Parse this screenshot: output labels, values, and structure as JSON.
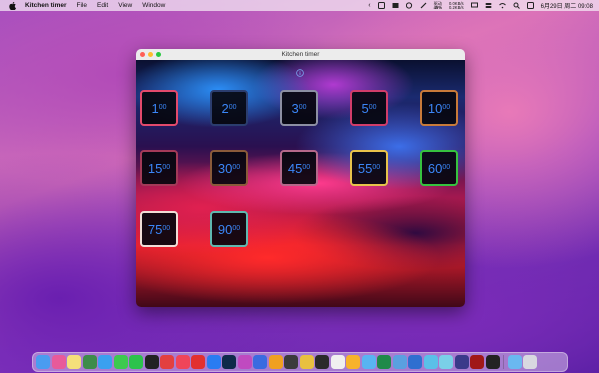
{
  "menubar": {
    "app_name": "Kitchen timer",
    "items": [
      "File",
      "Edit",
      "View",
      "Window"
    ],
    "stats_top": "驱动",
    "stats_pct": "45%",
    "stats_net_top": "0.0KB/s",
    "stats_net_bottom": "0.2KB/s",
    "datetime": "6月29日 周二  09:08"
  },
  "window": {
    "title": "Kitchen timer"
  },
  "timers": [
    {
      "value": "1",
      "unit": "00",
      "border": "#e24a6c"
    },
    {
      "value": "2",
      "unit": "00",
      "border": "#2b3d6e"
    },
    {
      "value": "3",
      "unit": "00",
      "border": "#8c8fa3"
    },
    {
      "value": "5",
      "unit": "00",
      "border": "#d13d6a"
    },
    {
      "value": "10",
      "unit": "00",
      "border": "#c77a3a"
    },
    {
      "value": "15",
      "unit": "00",
      "border": "#a33a58"
    },
    {
      "value": "30",
      "unit": "00",
      "border": "#8a5a3a"
    },
    {
      "value": "45",
      "unit": "00",
      "border": "#b4688a"
    },
    {
      "value": "55",
      "unit": "00",
      "border": "#e7c34b"
    },
    {
      "value": "60",
      "unit": "00",
      "border": "#36c23f"
    },
    {
      "value": "75",
      "unit": "00",
      "border": "#f0dcd6"
    },
    {
      "value": "90",
      "unit": "00",
      "border": "#5fb8b0"
    }
  ],
  "dock": {
    "apps": [
      {
        "name": "finder",
        "color": "#4a9cf0"
      },
      {
        "name": "launchpad",
        "color": "#e85a9a"
      },
      {
        "name": "notes",
        "color": "#f5e07a"
      },
      {
        "name": "terminal-app",
        "color": "#3d8c4a"
      },
      {
        "name": "safari",
        "color": "#3aa0f0"
      },
      {
        "name": "messages",
        "color": "#3dc94f"
      },
      {
        "name": "wechat",
        "color": "#2cc24c"
      },
      {
        "name": "qq",
        "color": "#222"
      },
      {
        "name": "alipay",
        "color": "#e24040"
      },
      {
        "name": "music",
        "color": "#f0455a"
      },
      {
        "name": "netease",
        "color": "#e23030"
      },
      {
        "name": "app-store",
        "color": "#2a7cf2"
      },
      {
        "name": "photoshop",
        "color": "#0f2a4a"
      },
      {
        "name": "affinity",
        "color": "#c04ac0"
      },
      {
        "name": "xcode",
        "color": "#3a6be0"
      },
      {
        "name": "sublime",
        "color": "#f0a020"
      },
      {
        "name": "tool",
        "color": "#3b3b3b"
      },
      {
        "name": "chrome",
        "color": "#e8c040"
      },
      {
        "name": "terminal",
        "color": "#2a2a2a"
      },
      {
        "name": "pen",
        "color": "#f0f0f0"
      },
      {
        "name": "sketch",
        "color": "#f7b32b"
      },
      {
        "name": "icloud",
        "color": "#58b4f2"
      },
      {
        "name": "excel",
        "color": "#1f8a4a"
      },
      {
        "name": "preview",
        "color": "#5aa0e0"
      },
      {
        "name": "network",
        "color": "#2f6fd0"
      },
      {
        "name": "vpn",
        "color": "#5ac0e8"
      },
      {
        "name": "browser",
        "color": "#7ad0e8"
      },
      {
        "name": "screen",
        "color": "#3a3a8a"
      },
      {
        "name": "red-app",
        "color": "#a01818"
      },
      {
        "name": "activity",
        "color": "#222"
      }
    ],
    "trailing": [
      {
        "name": "downloads",
        "color": "#6ab8f0"
      },
      {
        "name": "trash",
        "color": "#d8d8e0"
      }
    ]
  },
  "colors": {
    "timer_text": "#3b86f7",
    "titlebar": "#ececec"
  }
}
